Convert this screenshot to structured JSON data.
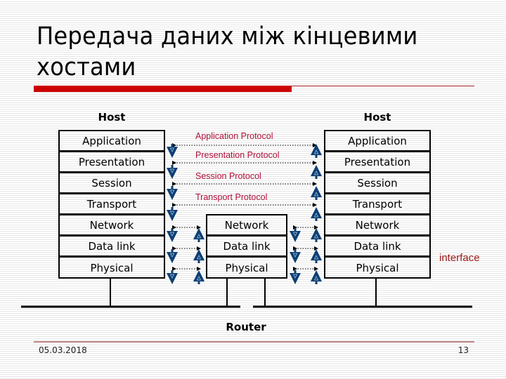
{
  "slide": {
    "title": "Передача даних між кінцевими хостами",
    "date": "05.03.2018",
    "page_number": "13"
  },
  "diagram": {
    "left_host": {
      "label": "Host",
      "layers": [
        "Application",
        "Presentation",
        "Session",
        "Transport",
        "Network",
        "Data link",
        "Physical"
      ]
    },
    "right_host": {
      "label": "Host",
      "layers": [
        "Application",
        "Presentation",
        "Session",
        "Transport",
        "Network",
        "Data link",
        "Physical"
      ]
    },
    "router": {
      "label": "Router",
      "layers": [
        "Network",
        "Data link",
        "Physical"
      ]
    },
    "protocols": [
      "Application Protocol",
      "Presentation Protocol",
      "Session Protocol",
      "Transport Protocol"
    ],
    "interface_label": "interface",
    "colors": {
      "accent_red": "#cc0000",
      "protocol_text": "#b0103a",
      "arrow_blue": "#0d3f73",
      "interface_text": "#9c1a1a"
    }
  }
}
